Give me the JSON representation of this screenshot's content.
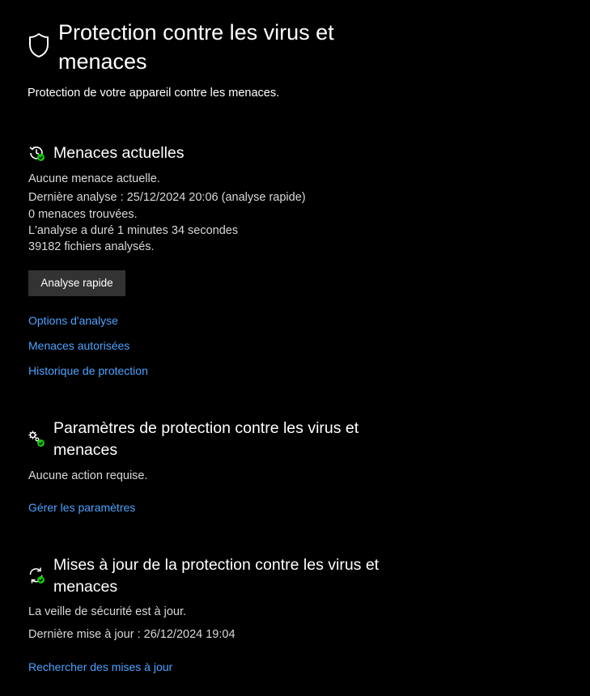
{
  "header": {
    "title": "Protection contre les virus et menaces",
    "subtitle": "Protection de votre appareil contre les menaces.",
    "icon": "shield-icon"
  },
  "current_threats": {
    "title": "Menaces actuelles",
    "icon": "scan-history-icon",
    "status": "Aucune menace actuelle.",
    "last_scan": "Dernière analyse : 25/12/2024 20:06 (analyse rapide)",
    "threats_found": "0 menaces trouvées.",
    "duration": "L'analyse a duré 1 minutes 34 secondes",
    "files_scanned": "39182 fichiers analysés.",
    "quick_scan_button": "Analyse rapide",
    "links": {
      "scan_options": "Options d'analyse",
      "allowed_threats": "Menaces autorisées",
      "protection_history": "Historique de protection"
    }
  },
  "settings": {
    "title": "Paramètres de protection contre les virus et menaces",
    "icon": "settings-gears-icon",
    "status": "Aucune action requise.",
    "manage_link": "Gérer les paramètres"
  },
  "updates": {
    "title": "Mises à jour de la protection contre les virus et menaces",
    "icon": "update-sync-icon",
    "status": "La veille de sécurité est à jour.",
    "last_update": "Dernière mise à jour : 26/12/2024 19:04",
    "check_link": "Rechercher des mises à jour"
  },
  "colors": {
    "background": "#000000",
    "link": "#4ca3ff",
    "button": "#333333",
    "status_ok": "#16c60c"
  }
}
